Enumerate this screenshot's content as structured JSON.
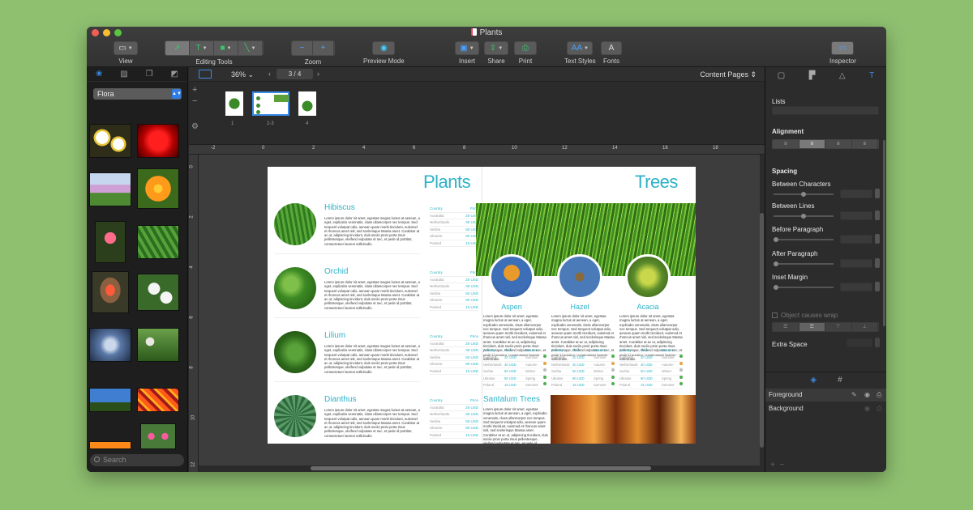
{
  "window": {
    "title": "Plants",
    "lights": [
      "#ee5f56",
      "#f5bd2f",
      "#58c63f"
    ]
  },
  "toolbar": {
    "view": "View",
    "editing_tools": "Editing Tools",
    "zoom": "Zoom",
    "preview_mode": "Preview Mode",
    "insert": "Insert",
    "share": "Share",
    "print": "Print",
    "text_styles": "Text Styles",
    "fonts": "Fonts",
    "inspector": "Inspector",
    "fonts_glyph": "A",
    "text_styles_glyph": "AA",
    "zoom_out": "−",
    "zoom_in": "+"
  },
  "library": {
    "category": "Flora",
    "search_placeholder": "Search"
  },
  "editor": {
    "zoom": "36%",
    "page_indicator": "3 / 4",
    "view_mode": "Content Pages",
    "page_labels": [
      "1",
      "2-3",
      "4"
    ],
    "ruler_h": [
      "-2",
      "0",
      "2",
      "4",
      "6",
      "8",
      "10",
      "12",
      "14",
      "16",
      "18"
    ],
    "ruler_v": [
      "0",
      "2",
      "4",
      "6",
      "8",
      "10",
      "12"
    ]
  },
  "document": {
    "left_title": "Plants",
    "right_title": "Trees",
    "lorem": "Lorem ipsum dolor sit amet, egestas magna luctus at aenean, a eget, explicabo venenatis, class ullamcorper nec tempus. Sed torquent volutpat odio, aenean quam morbi tincidunt, euismod et rhoncus amet nisl, sed scelerisque Massa amet. Curabitur at ac ut, adipiscing tincidunt, duis sociis proin porta risus pellentesque, eleifend vulputate et nec, et pede id porttitor, consectetuer laoreet sollicitudin.",
    "table_headers": {
      "country": "Country",
      "price": "Price",
      "season": "Season"
    },
    "countries": [
      "Australia",
      "Netherlands",
      "Serbia",
      "Ukraine",
      "Poland"
    ],
    "plants": [
      {
        "name": "Hibiscus",
        "prices": [
          "20 USD",
          "30 USD",
          "50 USD",
          "90 USD",
          "15 USD"
        ]
      },
      {
        "name": "Orchid",
        "prices": [
          "20 USD",
          "30 USD",
          "50 USD",
          "90 USD",
          "15 USD"
        ]
      },
      {
        "name": "Lilium",
        "prices": [
          "20 USD",
          "30 USD",
          "50 USD",
          "90 USD",
          "15 USD"
        ]
      },
      {
        "name": "Dianthus",
        "prices": [
          "20 USD",
          "30 USD",
          "50 USD",
          "90 USD",
          "15 USD"
        ]
      }
    ],
    "trees": [
      {
        "name": "Aspen"
      },
      {
        "name": "Hazel"
      },
      {
        "name": "Acacia"
      }
    ],
    "tree_prices": [
      "20 USD",
      "30 USD",
      "50 USD",
      "90 USD",
      "15 USD"
    ],
    "seasons": [
      "Summer",
      "Autumn",
      "Winter",
      "Spring",
      "Summer"
    ],
    "season_colors": [
      "#4caf50",
      "#e8a33d",
      "#bbbbbb",
      "#4caf50",
      "#4caf50"
    ],
    "section2_title": "Santalum Trees"
  },
  "inspector": {
    "lists": "Lists",
    "alignment": "Alignment",
    "spacing": "Spacing",
    "between_characters": "Between Characters",
    "between_lines": "Between Lines",
    "before_paragraph": "Before Paragraph",
    "after_paragraph": "After Paragraph",
    "inset_margin": "Inset Margin",
    "object_wrap": "Object causes wrap",
    "extra_space": "Extra Space",
    "layers": [
      "Foreground",
      "Background"
    ]
  }
}
